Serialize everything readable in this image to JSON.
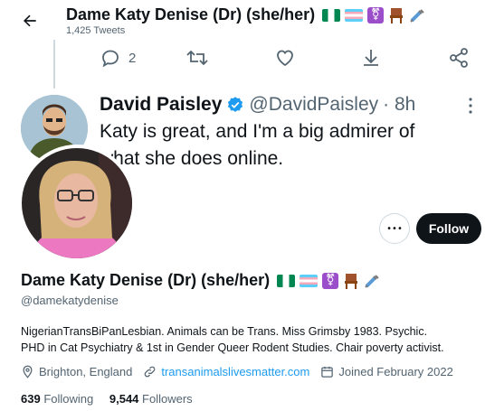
{
  "header": {
    "name": "Dame Katy Denise (Dr) (she/her)",
    "tweet_count": "1,425 Tweets"
  },
  "tweet_actions": {
    "reply_count": "2"
  },
  "embedded_tweet": {
    "author": "David Paisley",
    "handle": "@DavidPaisley",
    "time": "· 8h",
    "text_line1": "Katy is great, and I'm a big admirer of",
    "text_line2": "what she does online."
  },
  "profile": {
    "name": "Dame Katy Denise (Dr) (she/her)",
    "handle": "@damekatydenise",
    "bio_line1": "NigerianTransBiPanLesbian. Animals can be Trans. Miss Grimsby 1983. Psychic.",
    "bio_line2": "PHD in Cat Psychiatry & 1st in Gender Queer Rodent Studies. Chair poverty activist.",
    "location": "Brighton, England",
    "website": "transanimalslivesmatter.com",
    "joined": "Joined February 2022",
    "following_count": "639",
    "following_label": "Following",
    "followers_count": "9,544",
    "followers_label": "Followers"
  },
  "buttons": {
    "follow": "Follow",
    "more": "•••"
  },
  "colors": {
    "follow_bg": "#0f1419",
    "link": "#1d9bf0",
    "secondary_text": "#536471",
    "verified": "#1d9bf0"
  },
  "icons": [
    "back-arrow-icon",
    "reply-icon",
    "retweet-icon",
    "like-icon",
    "share-icon",
    "share-network-icon",
    "more-icon",
    "location-icon",
    "link-icon",
    "calendar-icon"
  ]
}
